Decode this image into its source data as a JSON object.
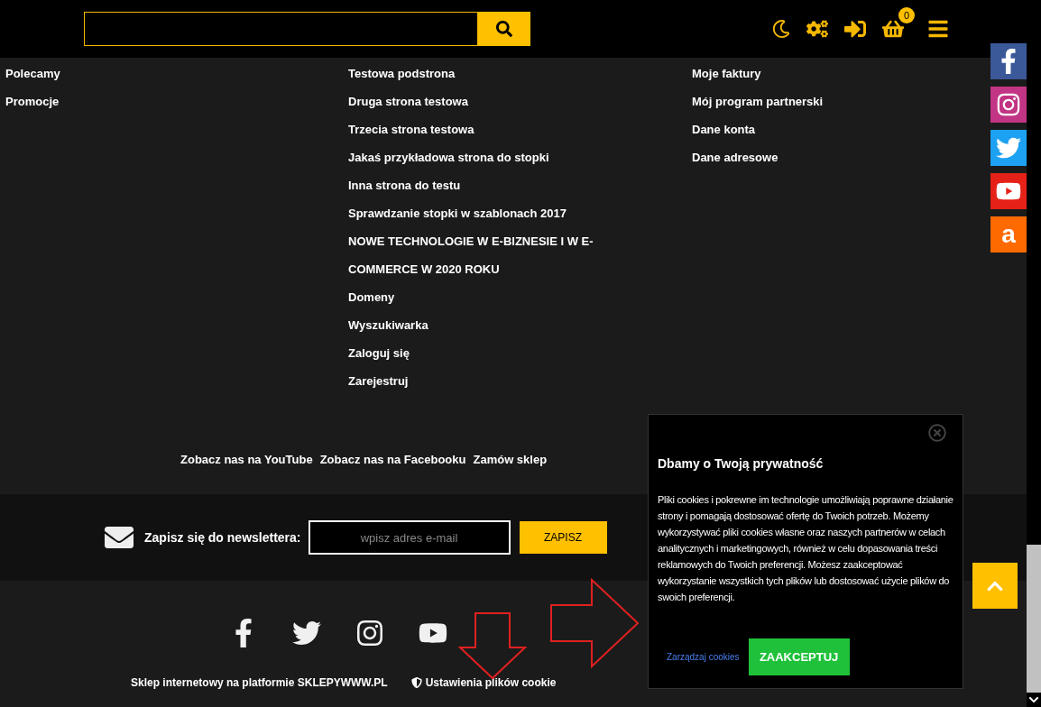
{
  "header": {
    "cart_count": "0"
  },
  "bottom_social": [
    {
      "kind": "facebook"
    },
    {
      "kind": "twitter"
    },
    {
      "kind": "instagram"
    },
    {
      "kind": "youtube"
    }
  ],
  "columns": [
    [
      "Polecamy",
      "Promocje"
    ],
    [
      "Testowa podstrona",
      "Druga strona testowa",
      "Trzecia strona testowa",
      "Jakaś przykładowa strona do stopki",
      "Inna strona do testu",
      "Sprawdzanie stopki w szablonach 2017",
      "NOWE TECHNOLOGIE W E-BIZNESIE I W E-COMMERCE W 2020 ROKU",
      "Domeny",
      "Wyszukiwarka",
      "Zaloguj się",
      "Zarejestruj"
    ],
    [
      "Moje faktury",
      "Mój program partnerski",
      "Dane konta",
      "Dane adresowe"
    ]
  ],
  "footer_links": [
    "Zobacz nas na YouTube",
    "Zobacz nas na Facebooku",
    "Zamów sklep"
  ],
  "newsletter": {
    "label": "Zapisz się do newslettera:",
    "placeholder": "wpisz adres e-mail",
    "button": "ZAPISZ"
  },
  "bottom": {
    "platform": "Sklep internetowy na platformie SKLEPYWWW.PL",
    "cookie_settings": "Ustawienia plików cookie"
  },
  "side_social": [
    {
      "kind": "facebook",
      "color": "#3b5998"
    },
    {
      "kind": "instagram",
      "color": "#c13584"
    },
    {
      "kind": "twitter",
      "color": "#1da1f2"
    },
    {
      "kind": "youtube",
      "color": "#e62117"
    },
    {
      "kind": "letter",
      "color": "#ff6a00",
      "label": "a"
    }
  ],
  "cookie_modal": {
    "title": "Dbamy o Twoją prywatność",
    "body": "Pliki cookies i pokrewne im technologie umożliwiają poprawne działanie strony i pomagają dostosować ofertę do Twoich potrzeb. Możemy wykorzystywać pliki cookies własne oraz naszych partnerów w celach analitycznych i marketingowych, również w celu dopasowania treści reklamowych do Twoich preferencji. Możesz zaakceptować wykorzystanie wszystkich tych plików lub dostosować użycie plików do swoich preferencji.",
    "manage": "Zarządzaj cookies",
    "accept": "ZAAKCEPTUJ"
  }
}
